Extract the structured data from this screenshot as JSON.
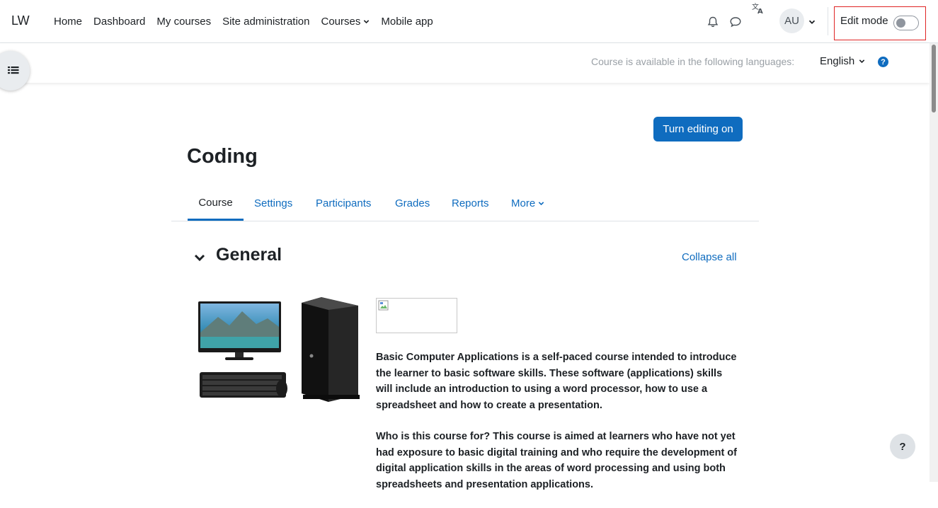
{
  "navbar": {
    "brand": "LW",
    "items": [
      {
        "label": "Home"
      },
      {
        "label": "Dashboard"
      },
      {
        "label": "My courses"
      },
      {
        "label": "Site administration"
      },
      {
        "label": "Courses",
        "has_dropdown": true
      },
      {
        "label": "Mobile app"
      }
    ],
    "avatar_initials": "AU",
    "edit_mode_label": "Edit mode",
    "edit_mode_on": false,
    "icons": [
      "bell-icon",
      "chat-icon",
      "translate-icon",
      "chevron-down-icon"
    ]
  },
  "subbar": {
    "language_note": "Course is available in the following languages:",
    "language_selected": "English",
    "help_glyph": "?"
  },
  "main": {
    "edit_button_label": "Turn editing on",
    "course_title": "Coding",
    "tabs": [
      {
        "label": "Course",
        "active": true
      },
      {
        "label": "Settings"
      },
      {
        "label": "Participants"
      },
      {
        "label": "Grades"
      },
      {
        "label": "Reports"
      },
      {
        "label": "More",
        "has_dropdown": true
      }
    ],
    "section_title": "General",
    "collapse_all_label": "Collapse all",
    "summary_paragraphs": [
      "Basic Computer Applications is a self-paced course intended to introduce the learner to basic software skills. These software (applications) skills will include an introduction to using a word processor, how to use a spreadsheet and how to create a presentation.",
      "Who is this course for?  This course is aimed at learners who have not yet had exposure to basic digital training and who require the development of digital application skills in the areas of word processing and using both spreadsheets and presentation applications."
    ]
  },
  "footer": {
    "help_button": "?"
  },
  "colors": {
    "primary": "#0f6cbf",
    "text": "#1d2125",
    "edit_mode_highlight": "#e02424"
  }
}
